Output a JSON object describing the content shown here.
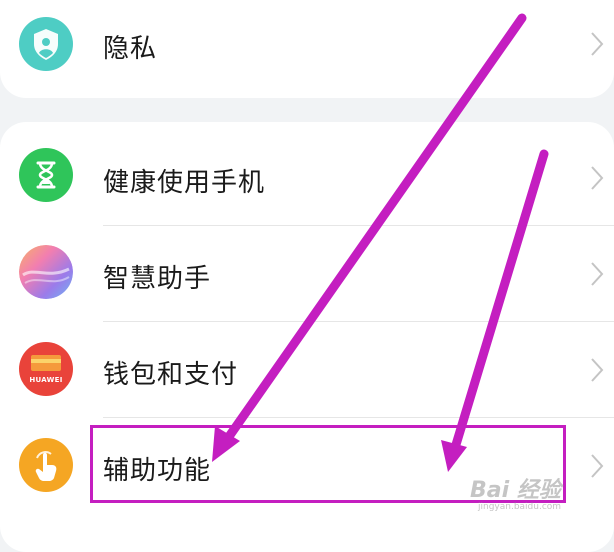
{
  "settings_items": [
    {
      "label": "隐私",
      "icon": "privacy-shield-icon"
    },
    {
      "label": "健康使用手机",
      "icon": "hourglass-icon"
    },
    {
      "label": "智慧助手",
      "icon": "assistant-icon"
    },
    {
      "label": "钱包和支付",
      "icon": "wallet-icon",
      "icon_text": "HUAWEI"
    },
    {
      "label": "辅助功能",
      "icon": "tap-hand-icon"
    }
  ],
  "colors": {
    "privacy": "#4ecdc4",
    "health": "#2fc55a",
    "wallet": "#e9433a",
    "accessibility": "#f5a623",
    "annotation": "#c41ec0"
  },
  "watermark": {
    "main": "Bai  经验",
    "sub": "jingyan.baidu.com"
  }
}
